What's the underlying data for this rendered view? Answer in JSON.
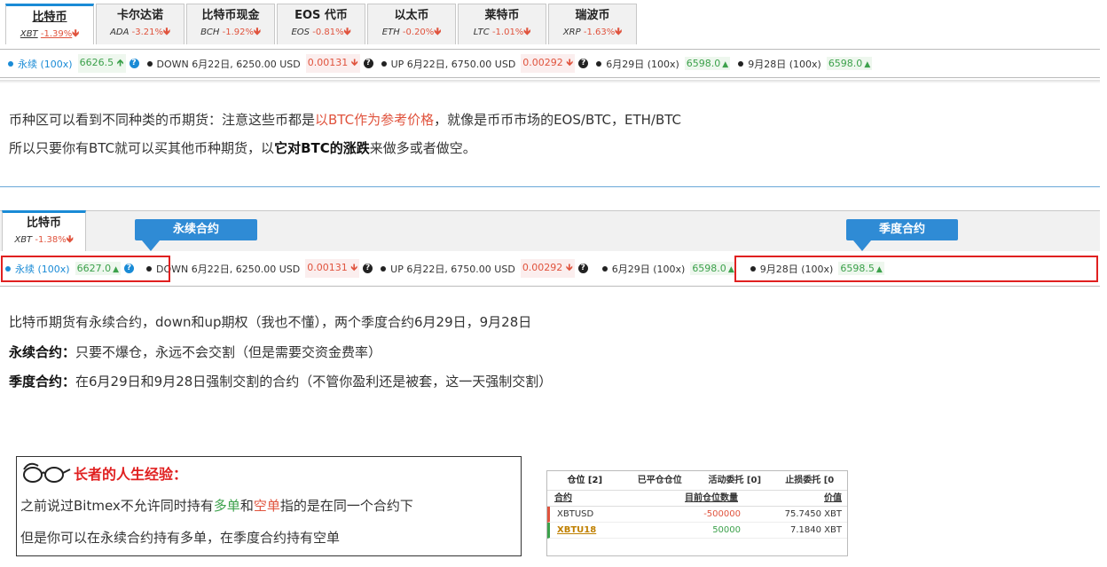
{
  "coin_tabs": [
    {
      "name": "比特币",
      "symbol": "XBT",
      "change": "-1.39%",
      "active": true
    },
    {
      "name": "卡尔达诺",
      "symbol": "ADA",
      "change": "-3.21%"
    },
    {
      "name": "比特币现金",
      "symbol": "BCH",
      "change": "-1.92%"
    },
    {
      "name": "EOS 代币",
      "symbol": "EOS",
      "change": "-0.81%"
    },
    {
      "name": "以太币",
      "symbol": "ETH",
      "change": "-0.20%"
    },
    {
      "name": "莱特币",
      "symbol": "LTC",
      "change": "-1.01%"
    },
    {
      "name": "瑞波币",
      "symbol": "XRP",
      "change": "-1.63%"
    }
  ],
  "contracts_top": {
    "perpetual": {
      "label": "永续 (100x)",
      "price": "6626.5"
    },
    "down": {
      "label": "DOWN 6月22日, 6250.00 USD",
      "price": "0.00131"
    },
    "up": {
      "label": "UP 6月22日, 6750.00 USD",
      "price": "0.00292"
    },
    "jun29": {
      "label": "6月29日 (100x)",
      "price": "6598.0"
    },
    "sep28": {
      "label": "9月28日 (100x)",
      "price": "6598.0"
    }
  },
  "text_block_1": {
    "line1_a": "币种区可以看到不同种类的币期货：注意这些币都是",
    "line1_red": "以BTC作为参考价格",
    "line1_b": "，就像是币币市场的EOS/BTC，ETH/BTC",
    "line2_a": "所以只要你有BTC就可以买其他币种期货，以",
    "line2_bold": "它对BTC的涨跌",
    "line2_b": "来做多或者做空。"
  },
  "panel2": {
    "tab": {
      "name": "比特币",
      "symbol": "XBT",
      "change": "-1.38%"
    },
    "callout_perpetual": "永续合约",
    "callout_quarterly": "季度合约",
    "perpetual": {
      "label": "永续 (100x)",
      "price": "6627.0"
    },
    "down": {
      "label": "DOWN 6月22日, 6250.00 USD",
      "price": "0.00131"
    },
    "up": {
      "label": "UP 6月22日, 6750.00 USD",
      "price": "0.00292"
    },
    "jun29": {
      "label": "6月29日 (100x)",
      "price": "6598.0"
    },
    "sep28": {
      "label": "9月28日 (100x)",
      "price": "6598.5"
    }
  },
  "text_block_2": {
    "line1": "比特币期货有永续合约，down和up期权（我也不懂），两个季度合约6月29日，9月28日",
    "line2_bold": "永续合约：",
    "line2": "只要不爆仓，永远不会交割（但是需要交资金费率）",
    "line3_bold": "季度合约：",
    "line3": "在6月29日和9月28日强制交割的合约（不管你盈利还是被套，这一天强制交割）"
  },
  "experience": {
    "title": "长者的人生经验：",
    "line1_a": "之前说过Bitmex不允许同时持有",
    "line1_long": "多单",
    "line1_and": "和",
    "line1_short": "空单",
    "line1_b": "指的是在同一个合约下",
    "line2": "但是你可以在永续合约持有多单，在季度合约持有空单"
  },
  "positions": {
    "tabs": [
      "仓位 [2]",
      "已平仓仓位",
      "活动委托 [0]",
      "止损委托 [0"
    ],
    "headers": [
      "合约",
      "目前仓位数量",
      "价值"
    ],
    "rows": [
      {
        "symbol": "XBTUSD",
        "qty": "-500000",
        "value": "75.7450 XBT"
      },
      {
        "symbol": "XBTU18",
        "qty": "50000",
        "value": "7.1840 XBT"
      }
    ]
  },
  "colors": {
    "accent": "#1a8bd6",
    "down": "#e0533d",
    "up": "#3ca14b",
    "callout": "#2f8bd5",
    "highlight_box": "#e02020"
  },
  "icons": [
    "down-arrow-icon",
    "up-arrow-icon",
    "question-icon",
    "glasses-icon"
  ]
}
